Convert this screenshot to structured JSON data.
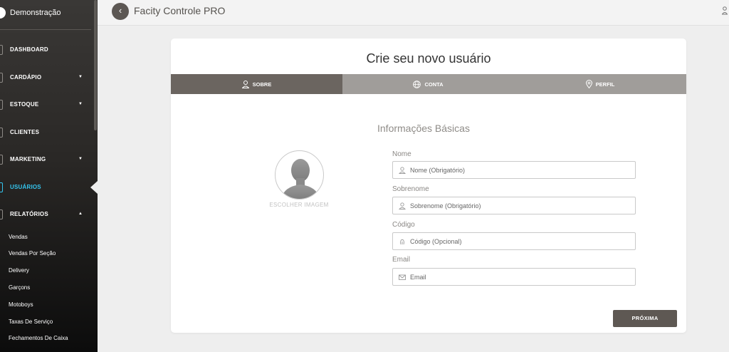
{
  "sidebar": {
    "brand": "Demonstração",
    "items": [
      {
        "label": "DASHBOARD"
      },
      {
        "label": "CARDÁPIO",
        "caret": "▼"
      },
      {
        "label": "ESTOQUE",
        "caret": "▼"
      },
      {
        "label": "CLIENTES"
      },
      {
        "label": "MARKETING",
        "caret": "▼"
      },
      {
        "label": "USUÁRIOS",
        "active": true
      },
      {
        "label": "RELATÓRIOS",
        "caret": "▲"
      }
    ],
    "sub_items": [
      "Vendas",
      "Vendas Por Seção",
      "Delivery",
      "Garçons",
      "Motoboys",
      "Taxas De Serviço",
      "Fechamentos De Caixa"
    ],
    "active_color": "#34c6f0"
  },
  "header": {
    "back_icon": "‹",
    "title": "Facity Controle PRO"
  },
  "form": {
    "title": "Crie seu novo usuário",
    "steps": [
      {
        "label": "SOBRE",
        "icon": "user-icon",
        "active": true
      },
      {
        "label": "CONTA",
        "icon": "globe-icon",
        "active": false
      },
      {
        "label": "PERFIL",
        "icon": "location-pin-icon",
        "active": false
      }
    ],
    "section_title": "Informações Básicas",
    "choose_image": "ESCOLHER IMAGEM",
    "fields": [
      {
        "label": "Nome",
        "placeholder": "Nome (Obrigatório)",
        "value": ""
      },
      {
        "label": "Sobrenome",
        "placeholder": "Sobrenome (Obrigatório)",
        "value": ""
      },
      {
        "label": "Código",
        "placeholder": "Código (Opcional)",
        "value": ""
      },
      {
        "label": "Email",
        "placeholder": "Email",
        "value": ""
      }
    ],
    "next_label": "PRÓXIMA"
  },
  "colors": {
    "step_active": "#6b6560",
    "step_inactive": "#a09d9a",
    "button": "#5e5853"
  }
}
